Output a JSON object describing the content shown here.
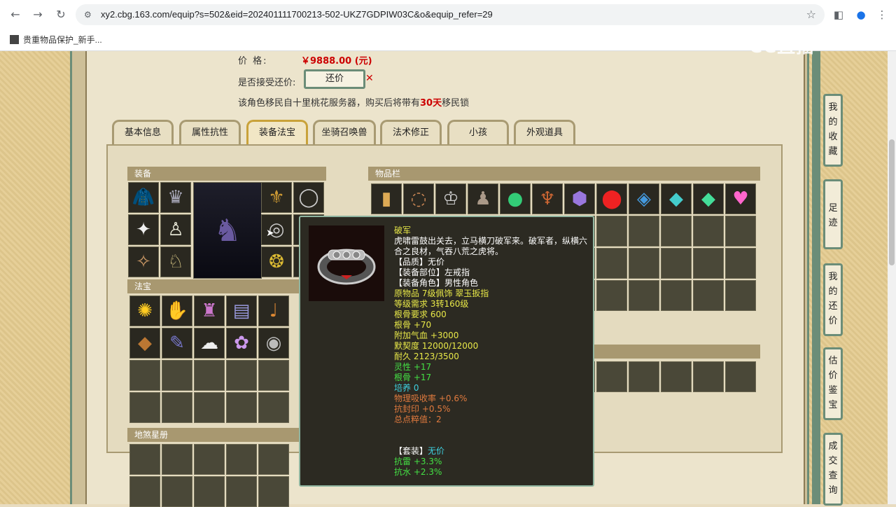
{
  "browser": {
    "url": "xy2.cbg.163.com/equip?s=502&eid=202401111700213-502-UKZ7GDPIW03C&o&equip_refer=29",
    "bookmark": "贵重物品保护_新手..."
  },
  "watermark": "CC直播",
  "price": {
    "label": "价 格:",
    "value": "￥9888.00 (元)"
  },
  "bargain": {
    "label": "是否接受还价:",
    "button": "还价"
  },
  "migrate": {
    "prefix": "该角色移民自十里桃花服务器，购买后将带有",
    "days": "30天",
    "suffix": "移民锁"
  },
  "tabs": [
    "基本信息",
    "属性抗性",
    "装备法宝",
    "坐骑召唤兽",
    "法术修正",
    "小孩",
    "外观道具"
  ],
  "sections": {
    "equip": "装备",
    "fabao": "法宝",
    "dishachece": "地煞星册",
    "inventory": "物品栏"
  },
  "equip_icons": [
    "red-armor-icon",
    "silver-crown-icon",
    "gold-belt-icon",
    "chain-necklace-icon",
    "white-cloth-icon",
    "white-robe-icon",
    "ring-icon",
    "charm-icon",
    "boots-icon",
    "gold-necklace-icon"
  ],
  "fabao_icons": [
    "gold-ore-icon",
    "fan-icon",
    "basket-icon",
    "scroll-icon",
    "horn-icon",
    "chest-icon",
    "feather-icon",
    "fur-icon",
    "flower-icon",
    "mirror-icon"
  ],
  "inventory_icons": [
    "gold-pillar-icon",
    "bronze-ring-icon",
    "crown-icon",
    "warrior-icon",
    "jade-orb-icon",
    "dagger-icon",
    "purple-bag-icon",
    "ruby-icon",
    "sapphire-icon",
    "cyan-gem-icon",
    "green-gem-icon",
    "pink-heart-icon"
  ],
  "tooltip": {
    "name": "破军",
    "desc": "虎啸雷鼓出关去，立马横刀破军来。破军者，纵横六合之良材，气吞八荒之虎将。",
    "lines": [
      {
        "text": "【品质】无价",
        "color": "w"
      },
      {
        "text": "【装备部位】左戒指",
        "color": "w"
      },
      {
        "text": "【装备角色】男性角色",
        "color": "w"
      },
      {
        "text": "原物品 7级佩饰 翠玉扳指",
        "color": "y"
      },
      {
        "text": "等级需求 3转160级",
        "color": "y"
      },
      {
        "text": "根骨要求 600",
        "color": "y"
      },
      {
        "text": "根骨 +70",
        "color": "y"
      },
      {
        "text": "附加气血 +3000",
        "color": "y"
      },
      {
        "text": "默契度 12000/12000",
        "color": "y"
      },
      {
        "text": "耐久 2123/3500",
        "color": "y"
      },
      {
        "text": "灵性 +17",
        "color": "g"
      },
      {
        "text": "根骨 +17",
        "color": "g"
      },
      {
        "text": "培养 0",
        "color": "c"
      },
      {
        "text": "物理吸收率 +0.6%",
        "color": "o"
      },
      {
        "text": "抗封印 +0.5%",
        "color": "o"
      },
      {
        "text": "总点粹值：2",
        "color": "o"
      }
    ],
    "set_label": "【套装】",
    "set_value": "无价",
    "set_lines": [
      "抗雷 +3.3%",
      "抗水 +2.3%"
    ]
  },
  "sidebar": [
    "我的收藏",
    "足迹",
    "我的还价",
    "估价鉴宝",
    "成交查询"
  ]
}
